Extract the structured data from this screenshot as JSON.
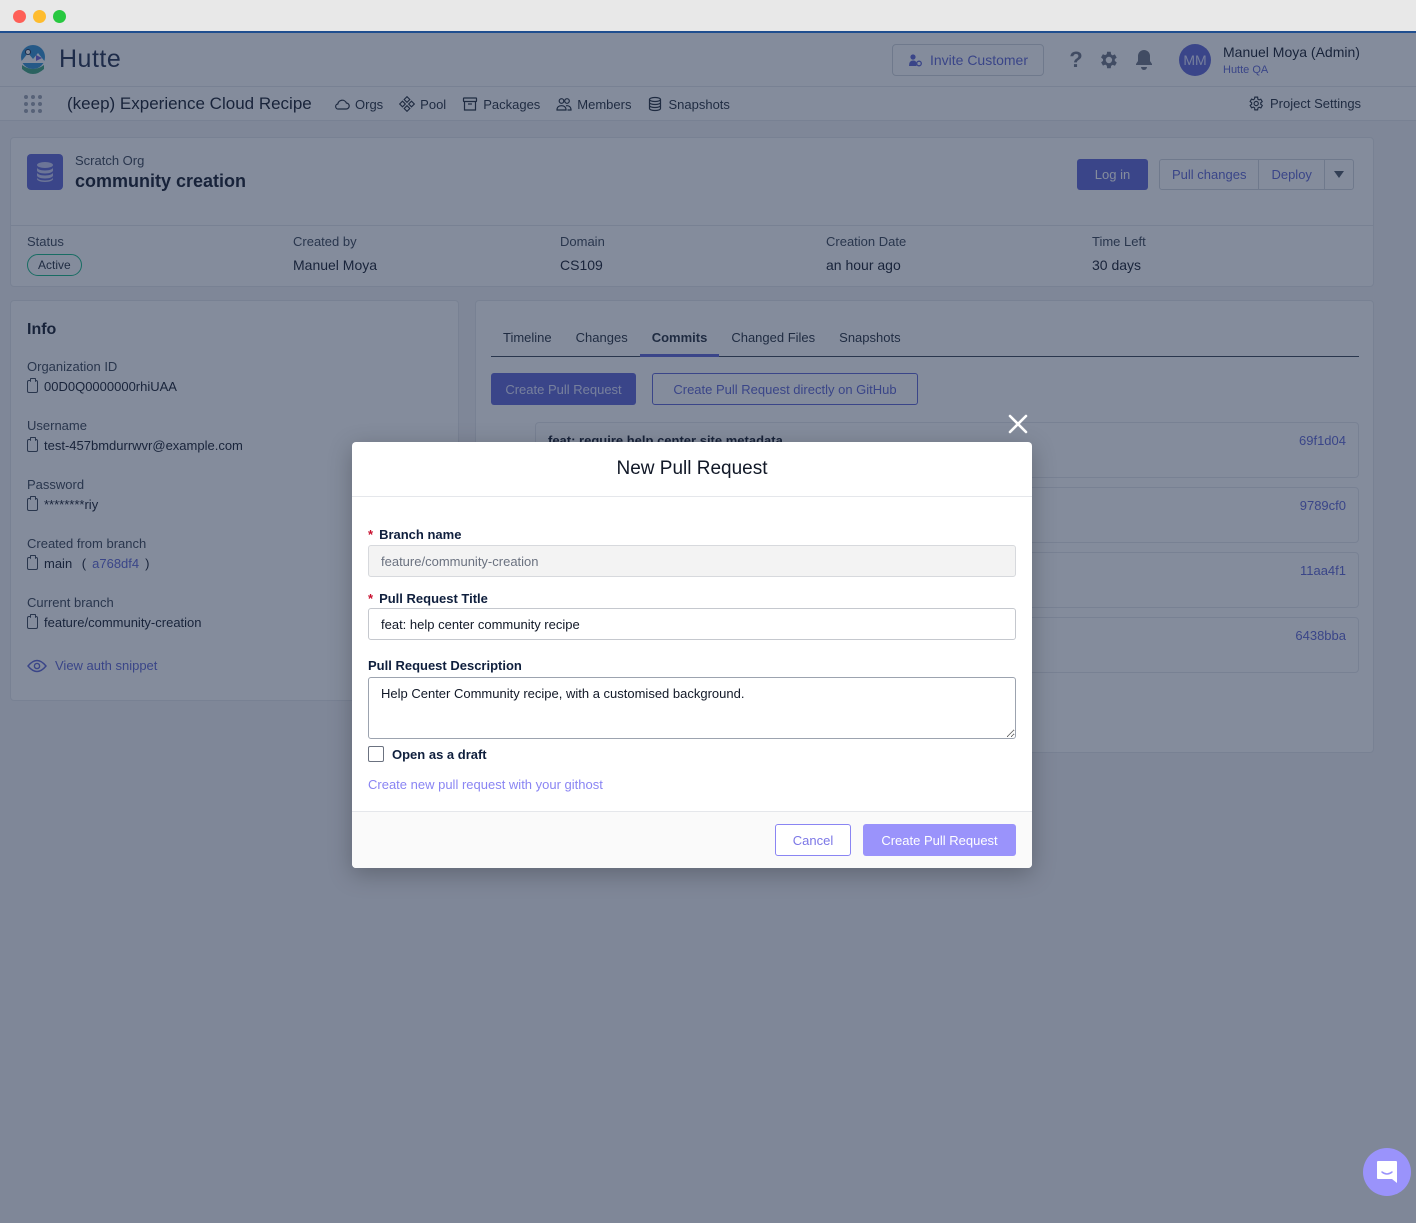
{
  "window": {
    "controls": [
      "close",
      "minimize",
      "maximize"
    ]
  },
  "header": {
    "brand": "Hutte",
    "invite_label": "Invite Customer",
    "help_icon": "?",
    "user": {
      "initials": "MM",
      "name": "Manuel Moya (Admin)",
      "org": "Hutte QA"
    }
  },
  "subnav": {
    "project_name": "(keep) Experience Cloud Recipe",
    "items": [
      {
        "label": "Orgs",
        "icon": "cloud-icon"
      },
      {
        "label": "Pool",
        "icon": "pool-icon"
      },
      {
        "label": "Packages",
        "icon": "package-icon"
      },
      {
        "label": "Members",
        "icon": "members-icon"
      },
      {
        "label": "Snapshots",
        "icon": "database-icon"
      }
    ],
    "project_settings": "Project Settings"
  },
  "org": {
    "type": "Scratch Org",
    "name": "community creation",
    "login_label": "Log in",
    "pull_changes_label": "Pull changes",
    "deploy_label": "Deploy",
    "meta": [
      {
        "label": "Status",
        "value": "Active"
      },
      {
        "label": "Created by",
        "value": "Manuel Moya"
      },
      {
        "label": "Domain",
        "value": "CS109"
      },
      {
        "label": "Creation Date",
        "value": "an hour ago"
      },
      {
        "label": "Time Left",
        "value": "30 days"
      }
    ]
  },
  "info": {
    "title": "Info",
    "fields": [
      {
        "label": "Organization ID",
        "value": "00D0Q0000000rhiUAA"
      },
      {
        "label": "Username",
        "value": "test-457bmdurrwvr@example.com"
      },
      {
        "label": "Password",
        "value": "********riy"
      },
      {
        "label": "Created from branch",
        "value": "main",
        "commit": "a768df4"
      },
      {
        "label": "Current branch",
        "value": "feature/community-creation"
      }
    ],
    "auth_link": "View auth snippet"
  },
  "commits_panel": {
    "tabs": [
      {
        "label": "Timeline",
        "active": false
      },
      {
        "label": "Changes",
        "active": false
      },
      {
        "label": "Commits",
        "active": true
      },
      {
        "label": "Changed Files",
        "active": false
      },
      {
        "label": "Snapshots",
        "active": false
      }
    ],
    "create_pr_label": "Create Pull Request",
    "create_pr_github_label": "Create Pull Request directly on GitHub",
    "commits": [
      {
        "title": "feat: require help center site metadata",
        "sha": "69f1d04"
      },
      {
        "title": "",
        "sha": "9789cf0"
      },
      {
        "title": "",
        "sha": "11aa4f1"
      },
      {
        "title": "",
        "sha": "6438bba"
      }
    ]
  },
  "modal": {
    "title": "New Pull Request",
    "branch_label": "Branch name",
    "branch_value": "feature/community-creation",
    "pr_title_label": "Pull Request Title",
    "pr_title_value": "feat: help center community recipe",
    "description_label": "Pull Request Description",
    "description_value": "Help Center Community recipe, with a customised background.",
    "draft_label": "Open as a draft",
    "draft_checked": false,
    "githost_link": "Create new pull request with your githost",
    "cancel_label": "Cancel",
    "create_label": "Create Pull Request",
    "required_marker": "*"
  },
  "colors": {
    "accent": "#5c63d6",
    "accent_light": "#9a93fb",
    "status_active": "#10b981",
    "required": "#c8102e"
  }
}
